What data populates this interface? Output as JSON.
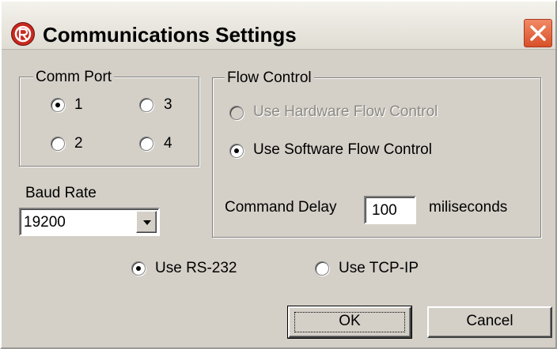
{
  "dialog": {
    "title": "Communications Settings"
  },
  "comm_port": {
    "legend": "Comm Port",
    "options": [
      {
        "label": "1",
        "selected": true
      },
      {
        "label": "3",
        "selected": false
      },
      {
        "label": "2",
        "selected": false
      },
      {
        "label": "4",
        "selected": false
      }
    ]
  },
  "baud_rate": {
    "label": "Baud Rate",
    "value": "19200"
  },
  "flow_control": {
    "legend": "Flow Control",
    "hardware_label": "Use Hardware Flow Control",
    "hardware_enabled": false,
    "software_label": "Use Software Flow Control",
    "software_selected": true,
    "command_delay_label": "Command Delay",
    "command_delay_value": "100",
    "command_delay_unit": "miliseconds"
  },
  "connection": {
    "rs232_label": "Use RS-232",
    "rs232_selected": true,
    "tcpip_label": "Use TCP-IP",
    "tcpip_selected": false
  },
  "buttons": {
    "ok": "OK",
    "cancel": "Cancel"
  },
  "colors": {
    "face": "#d4d0c8",
    "close_button": "#d8502a",
    "app_icon": "#c8291f"
  },
  "icons": {
    "app": "settings-app-icon",
    "close": "close-icon",
    "dropdown": "chevron-down-icon"
  }
}
